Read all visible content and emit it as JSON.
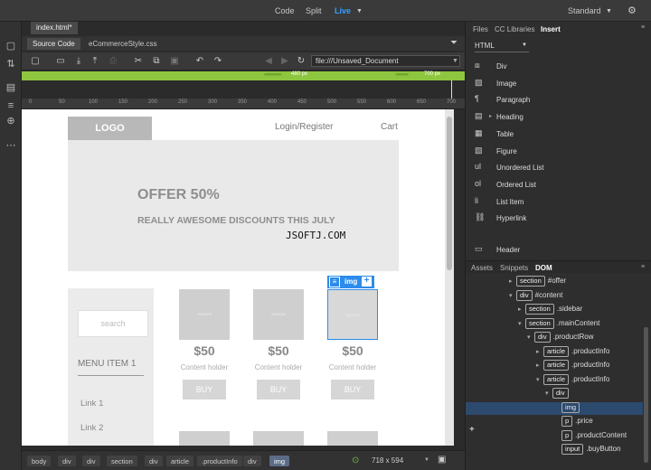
{
  "topbar": {
    "modes": [
      "Code",
      "Split",
      "Live"
    ],
    "active_mode": "Live",
    "workspace": "Standard"
  },
  "document": {
    "file_tab": "index.html*",
    "related_files": [
      "Source Code",
      "eCommerceStyle.css"
    ],
    "url": "file:///Unsaved_Document",
    "mq_left": "480  px",
    "mq_right": "700  px",
    "ruler": [
      "0",
      "50",
      "100",
      "150",
      "200",
      "250",
      "300",
      "350",
      "400",
      "450",
      "500",
      "550",
      "600",
      "650",
      "700"
    ]
  },
  "page": {
    "logo": "LOGO",
    "nav": [
      "Login/Register",
      "Cart"
    ],
    "hero_title": "OFFER 50%",
    "hero_sub": "REALLY AWESOME DISCOUNTS THIS JULY",
    "search_placeholder": "search",
    "menu_title": "MENU ITEM 1",
    "menu_links": [
      "Link 1",
      "Link 2"
    ],
    "products": [
      {
        "img": "200X200",
        "price": "$50",
        "content": "Content holder",
        "buy": "BUY"
      },
      {
        "img": "200X200",
        "price": "$50",
        "content": "Content holder",
        "buy": "BUY"
      },
      {
        "img": "200X200",
        "price": "$50",
        "content": "Content holder",
        "buy": "BUY"
      }
    ],
    "img_badge": "img",
    "watermark": "JSOFTJ.COM"
  },
  "statusbar": {
    "crumbs": [
      "body",
      "div",
      "div",
      "section",
      "div",
      "article",
      ".productInfo",
      "div",
      "img"
    ],
    "active_crumb": "img",
    "size": "718 x 594"
  },
  "rightpanel": {
    "tabs": [
      "Files",
      "CC Libraries",
      "Insert"
    ],
    "active_tab": "Insert",
    "html_select": "HTML",
    "insert_items": [
      {
        "icon": "div-icon",
        "label": "Div"
      },
      {
        "icon": "image-icon",
        "label": "Image"
      },
      {
        "icon": "paragraph-icon",
        "label": "Paragraph"
      },
      {
        "icon": "heading-icon",
        "label": "Heading"
      },
      {
        "icon": "table-icon",
        "label": "Table"
      },
      {
        "icon": "figure-icon",
        "label": "Figure"
      },
      {
        "icon": "unordered-list-icon",
        "label": "Unordered List"
      },
      {
        "icon": "ordered-list-icon",
        "label": "Ordered List"
      },
      {
        "icon": "list-item-icon",
        "label": "List Item"
      },
      {
        "icon": "hyperlink-icon",
        "label": "Hyperlink"
      },
      {
        "icon": "header-icon",
        "label": "Header"
      }
    ],
    "dom_tabs": [
      "Assets",
      "Snippets",
      "DOM"
    ],
    "active_dom_tab": "DOM",
    "dom_nodes": [
      {
        "tag": "section",
        "name": "#offer",
        "depth": 0,
        "arrow": "▸"
      },
      {
        "tag": "div",
        "name": "#content",
        "depth": 0,
        "arrow": "▾"
      },
      {
        "tag": "section",
        "name": ".sidebar",
        "depth": 1,
        "arrow": "▸"
      },
      {
        "tag": "section",
        "name": ".mainContent",
        "depth": 1,
        "arrow": "▾"
      },
      {
        "tag": "div",
        "name": ".productRow",
        "depth": 2,
        "arrow": "▾"
      },
      {
        "tag": "article",
        "name": ".productInfo",
        "depth": 3,
        "arrow": "▸"
      },
      {
        "tag": "article",
        "name": ".productInfo",
        "depth": 3,
        "arrow": "▸"
      },
      {
        "tag": "article",
        "name": ".productInfo",
        "depth": 3,
        "arrow": "▾"
      },
      {
        "tag": "div",
        "name": "",
        "depth": 4,
        "arrow": "▾"
      },
      {
        "tag": "img",
        "name": "",
        "depth": 5,
        "arrow": ""
      },
      {
        "tag": "p",
        "name": ".price",
        "depth": 5,
        "arrow": ""
      },
      {
        "tag": "p",
        "name": ".productContent",
        "depth": 5,
        "arrow": ""
      },
      {
        "tag": "input",
        "name": ".buyButton",
        "depth": 5,
        "arrow": ""
      }
    ],
    "selected_dom_index": 9
  }
}
